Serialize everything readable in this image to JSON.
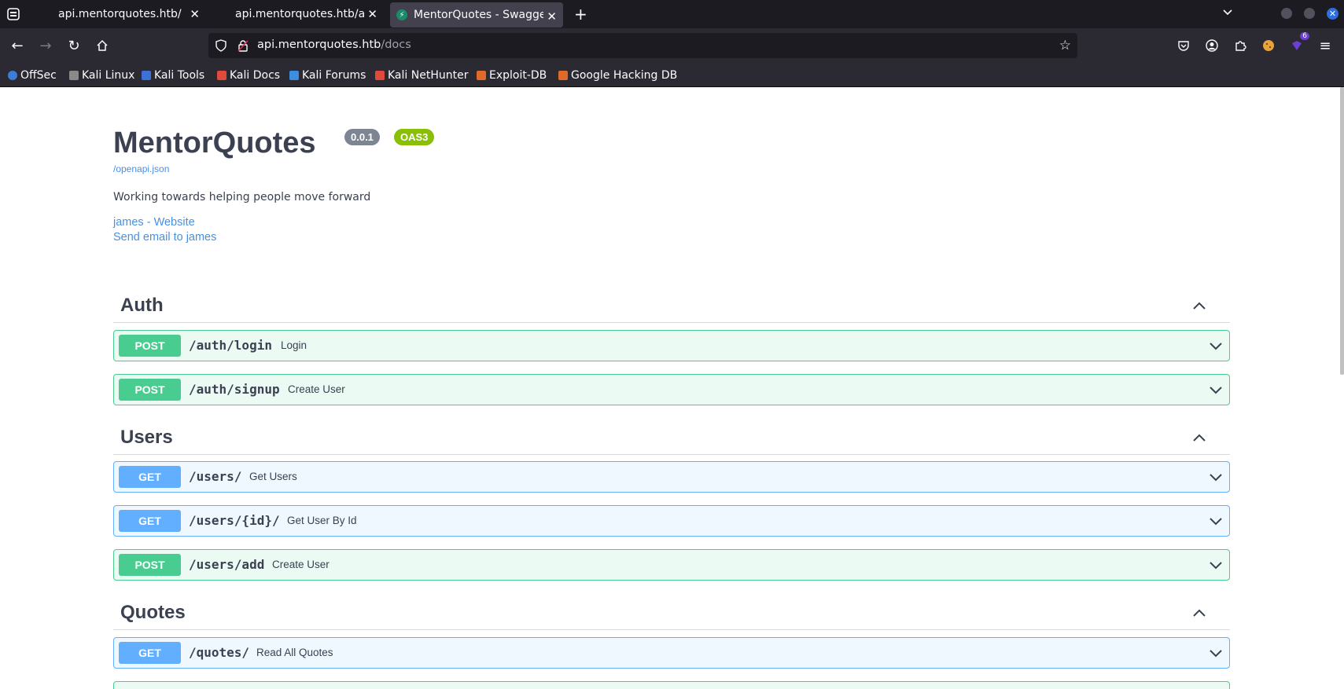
{
  "browser": {
    "tabs": [
      {
        "title": "api.mentorquotes.htb/",
        "active": false
      },
      {
        "title": "api.mentorquotes.htb/auth/login",
        "active": false
      },
      {
        "title": "MentorQuotes - Swagger UI",
        "active": true
      }
    ],
    "new_tab_icon": "plus-icon",
    "url_host": "api.mentorquotes.htb",
    "url_path": "/docs",
    "extension_badge": "6",
    "bookmarks": [
      {
        "label": "OffSec",
        "color": "#3d7dd8"
      },
      {
        "label": "Kali Linux",
        "color": "#8a8a8a"
      },
      {
        "label": "Kali Tools",
        "color": "#3d6fd8"
      },
      {
        "label": "Kali Docs",
        "color": "#e04a3a"
      },
      {
        "label": "Kali Forums",
        "color": "#3d8ee0"
      },
      {
        "label": "Kali NetHunter",
        "color": "#e04a3a"
      },
      {
        "label": "Exploit-DB",
        "color": "#e06a2a"
      },
      {
        "label": "Google Hacking DB",
        "color": "#e06a2a"
      }
    ]
  },
  "info": {
    "title": "MentorQuotes",
    "version": "0.0.1",
    "oas": "OAS3",
    "spec_link": "/openapi.json",
    "description": "Working towards helping people move forward",
    "contact_website": "james - Website",
    "contact_email": "Send email to james"
  },
  "colors": {
    "post": "#49cc90",
    "get": "#61affe",
    "text": "#3b4151",
    "link": "#4990e2"
  },
  "tags": [
    {
      "name": "Auth",
      "operations": [
        {
          "method": "POST",
          "path": "/auth/login",
          "summary": "Login"
        },
        {
          "method": "POST",
          "path": "/auth/signup",
          "summary": "Create User"
        }
      ]
    },
    {
      "name": "Users",
      "operations": [
        {
          "method": "GET",
          "path": "/users/",
          "summary": "Get Users"
        },
        {
          "method": "GET",
          "path": "/users/{id}/",
          "summary": "Get User By Id"
        },
        {
          "method": "POST",
          "path": "/users/add",
          "summary": "Create User"
        }
      ]
    },
    {
      "name": "Quotes",
      "operations": [
        {
          "method": "GET",
          "path": "/quotes/",
          "summary": "Read All Quotes"
        }
      ]
    }
  ]
}
